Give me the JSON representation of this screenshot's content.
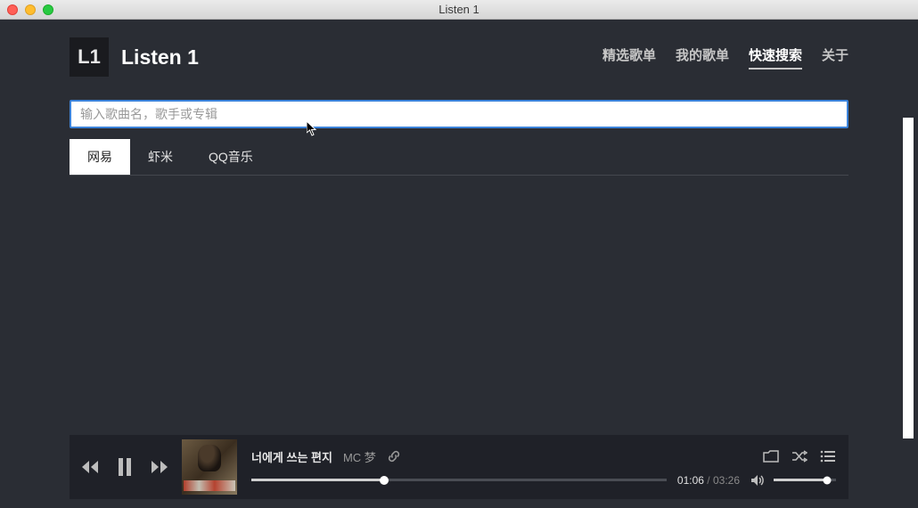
{
  "window": {
    "title": "Listen 1"
  },
  "header": {
    "app_name": "Listen 1",
    "logo_text": "L1"
  },
  "nav": {
    "items": [
      {
        "label": "精选歌单",
        "active": false
      },
      {
        "label": "我的歌单",
        "active": false
      },
      {
        "label": "快速搜索",
        "active": true
      },
      {
        "label": "关于",
        "active": false
      }
    ]
  },
  "search": {
    "placeholder": "输入歌曲名，歌手或专辑",
    "value": ""
  },
  "tabs": {
    "items": [
      {
        "label": "网易",
        "active": true
      },
      {
        "label": "虾米",
        "active": false
      },
      {
        "label": "QQ音乐",
        "active": false
      }
    ]
  },
  "player": {
    "track_title": "너에게 쓰는 편지",
    "track_artist": "MC 梦",
    "time_current": "01:06",
    "time_total": "03:26",
    "time_sep": " / "
  }
}
